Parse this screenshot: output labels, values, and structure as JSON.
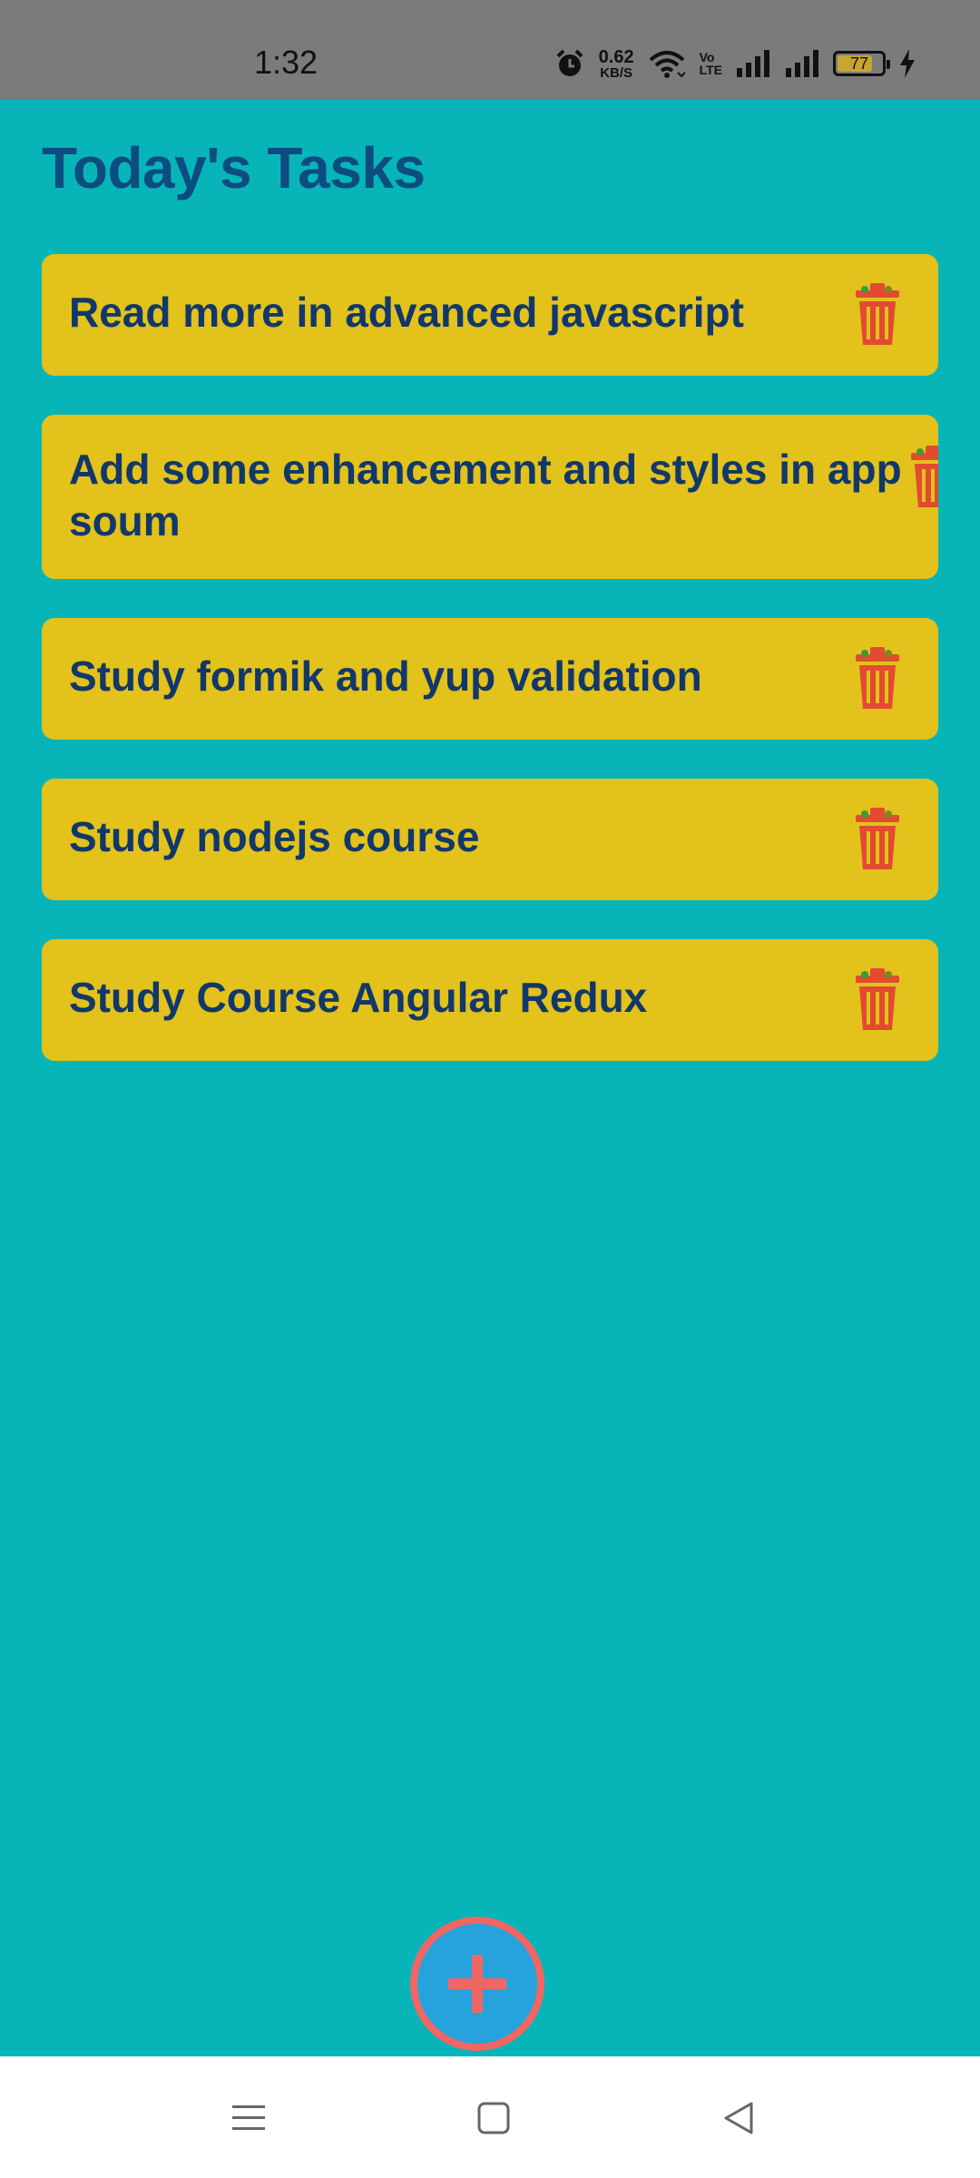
{
  "status_bar": {
    "time": "1:32",
    "speed_value": "0.62",
    "speed_unit": "KB/S",
    "volte_top": "Vo",
    "volte_bottom": "LTE",
    "battery": "77",
    "icons": [
      "alarm-icon",
      "wifi-icon",
      "signal-icon",
      "signal-icon",
      "battery-icon",
      "charging-icon"
    ]
  },
  "page": {
    "title": "Today's Tasks"
  },
  "tasks": [
    {
      "text": "Read more in advanced javascript"
    },
    {
      "line1": "Add some enhancement and styles in app",
      "line2": "soum"
    },
    {
      "text": "Study formik and yup validation"
    },
    {
      "text": "Study nodejs course"
    },
    {
      "text": "Study Course Angular Redux"
    }
  ],
  "fab": {
    "icon": "plus-icon"
  },
  "nav": {
    "icons": [
      "menu-icon",
      "home-icon",
      "back-icon"
    ]
  },
  "colors": {
    "background": "#07b5b9",
    "card": "#e2c21b",
    "text": "#12386b",
    "title": "#0d4c80",
    "trash": "#e24b31",
    "fab": "#26a3dd",
    "fab_ring": "#f06663"
  }
}
